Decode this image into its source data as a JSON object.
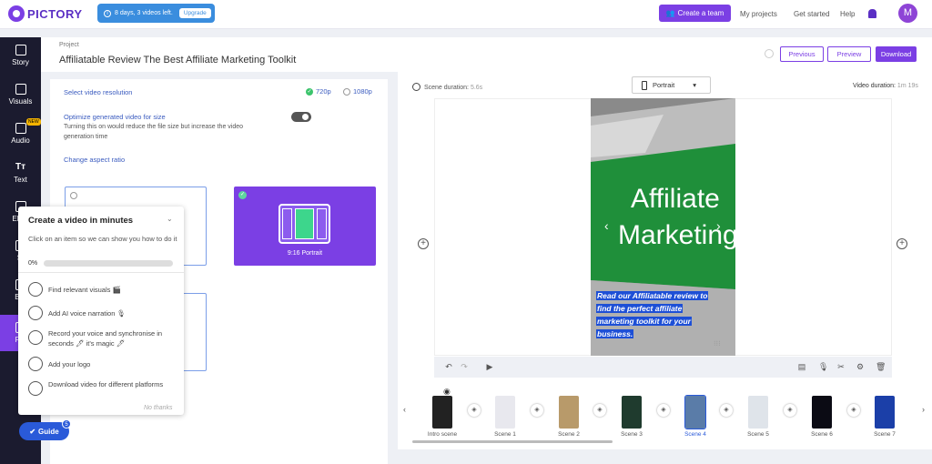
{
  "app": {
    "logo": "PICTORY"
  },
  "topbar": {
    "trial_text": "8 days, 3 videos left.",
    "upgrade": "Upgrade",
    "create_team": "Create a team",
    "nav": [
      "My projects",
      "Get started",
      "Help"
    ],
    "avatar": "M"
  },
  "sidebar": {
    "items": [
      {
        "label": "Story"
      },
      {
        "label": "Visuals"
      },
      {
        "label": "Audio",
        "badge": "NEW"
      },
      {
        "label": "Text"
      },
      {
        "label": "Elem"
      },
      {
        "label": "St"
      },
      {
        "label": "Bra"
      },
      {
        "label": "For"
      }
    ]
  },
  "header": {
    "project_label": "Project",
    "title": "Affiliatable Review The Best Affiliate Marketing Toolkit",
    "previous": "Previous",
    "preview": "Preview",
    "download": "Download"
  },
  "format_panel": {
    "resolution_label": "Select video resolution",
    "res_720": "720p",
    "res_1080": "1080p",
    "optimize_title": "Optimize generated video for size",
    "optimize_desc": "Turning this on would reduce the file size but increase the video generation time",
    "aspect_label": "Change aspect ratio",
    "selected_option": "9:16 Portrait"
  },
  "guide_popup": {
    "title": "Create a video in minutes",
    "subtitle": "Click on an item so we can show you how to do it",
    "progress": "0%",
    "items": [
      "Find relevant visuals 🎬",
      "Add AI voice narration 🎙",
      "Record your voice and synchronise in seconds 🖊 it's magic 🖊",
      "Add your logo",
      "Download video for different platforms"
    ],
    "no_thanks": "No thanks",
    "guide_button": "Guide",
    "guide_count": "5"
  },
  "preview": {
    "scene_duration_label": "Scene duration:",
    "scene_duration": "5.6s",
    "orientation": "Portrait",
    "video_duration_label": "Video duration:",
    "video_duration": "1m 19s",
    "image_text": "Affiliate Marketing",
    "caption": "Read our Affiliatable review to find the perfect affiliate marketing toolkit for your business."
  },
  "timeline": {
    "scenes": [
      "Intro scene",
      "Scene 1",
      "Scene 2",
      "Scene 3",
      "Scene 4",
      "Scene 5",
      "Scene 6",
      "Scene 7"
    ],
    "active_scene": "Scene 4"
  },
  "colors": {
    "accent": "#7b3fe4",
    "sidebar": "#1b1b2f",
    "trial": "#3a8dde"
  }
}
